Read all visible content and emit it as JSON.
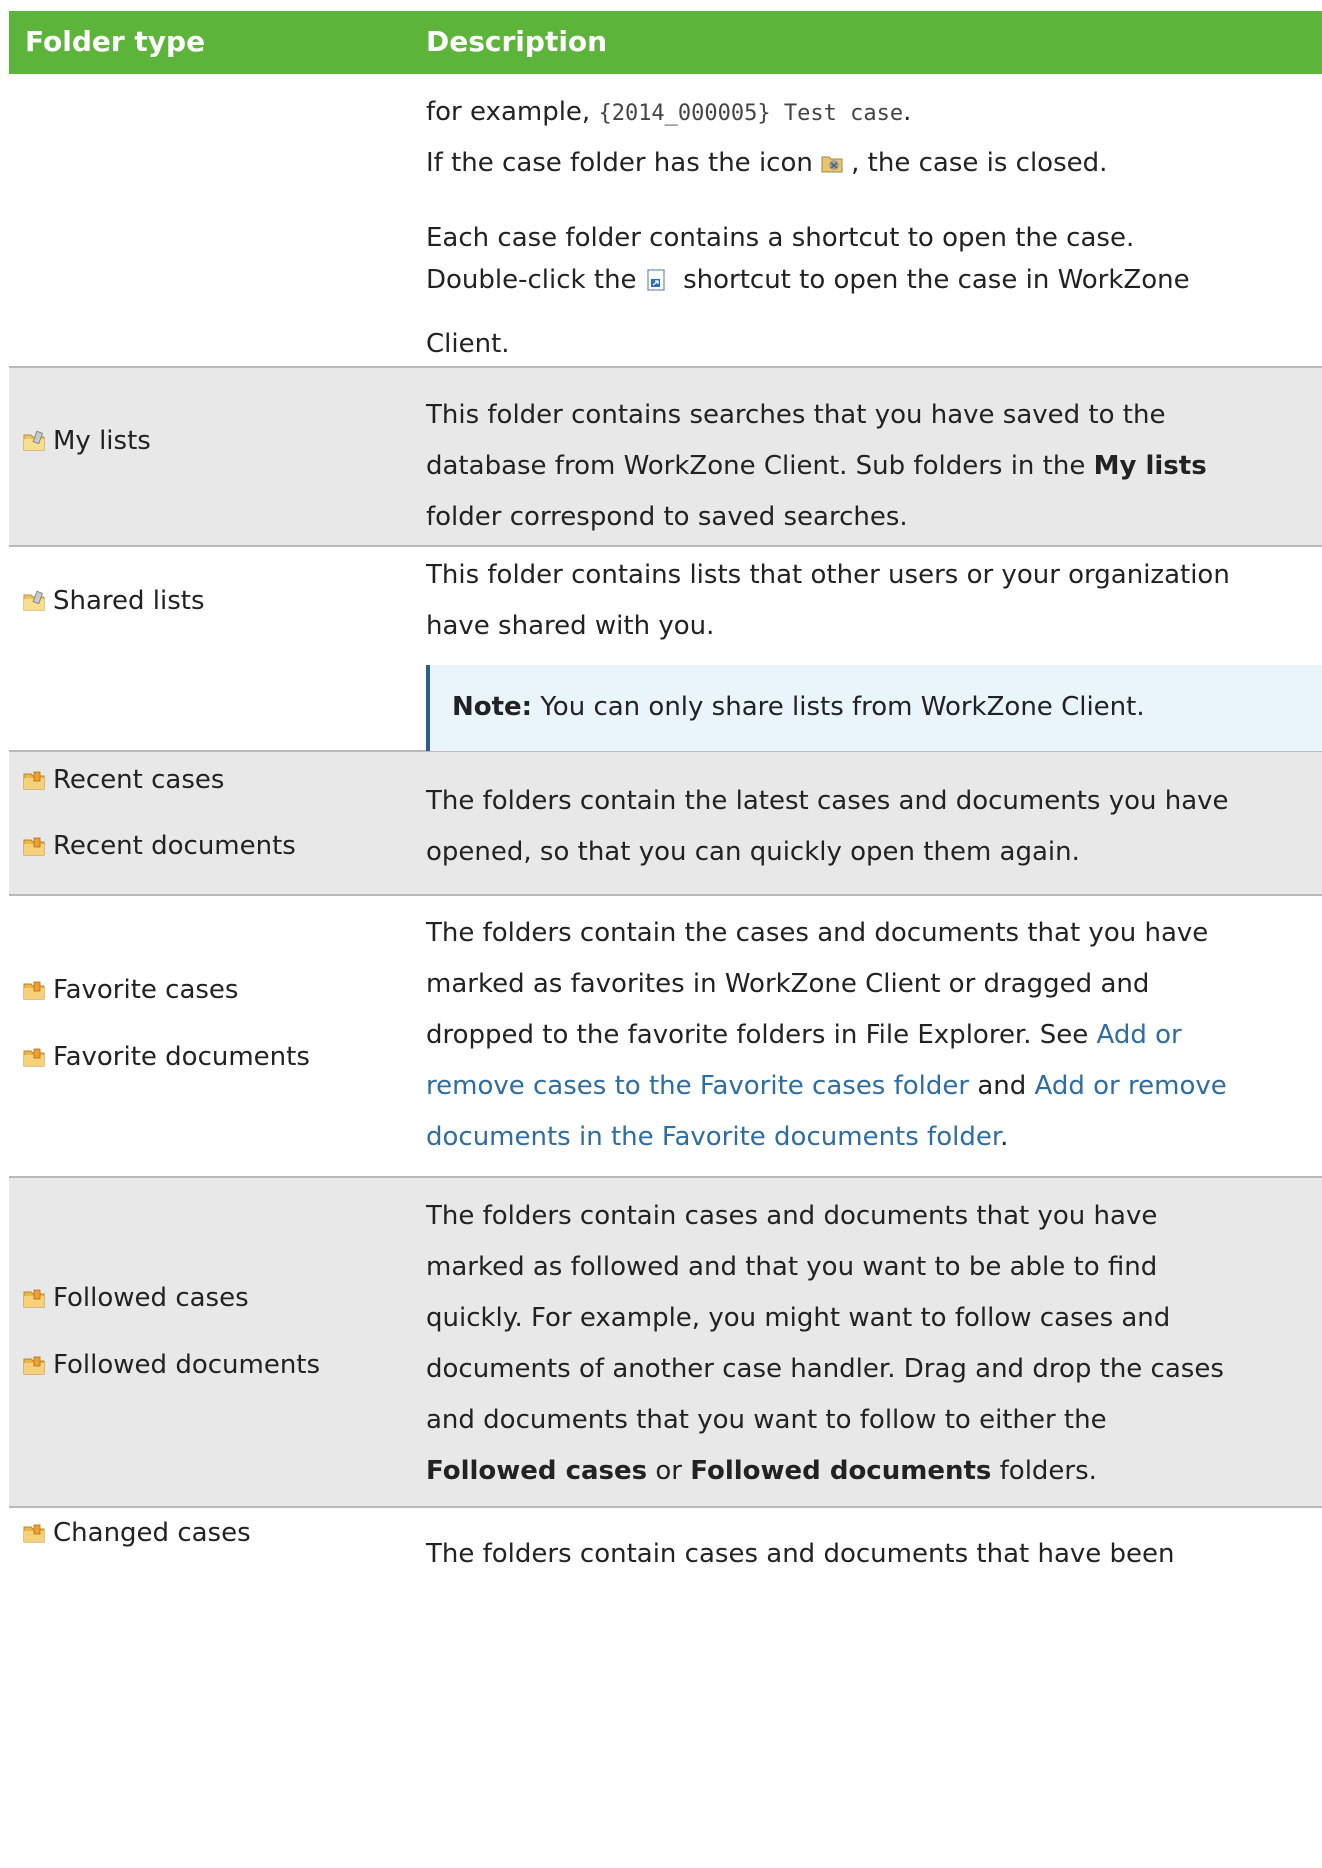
{
  "header": {
    "col1": "Folder type",
    "col2": "Description"
  },
  "row0": {
    "l1_pre": "for example, ",
    "l1_code": "{2014_000005} Test case",
    "l1_post": ".",
    "l2_pre": "If the case folder has the icon ",
    "l2_post": ", the case is closed.",
    "l3": "Each case folder contains a shortcut to open the case.",
    "l4_pre": "Double-click the ",
    "l4_post": " shortcut to open the case in WorkZone",
    "l5": "Client."
  },
  "my_lists": {
    "name": "My lists",
    "l1": "This folder contains searches that you have saved to the",
    "l2_pre": "database from WorkZone Client. Sub folders in the ",
    "l2_bold": "My lists",
    "l3": "folder correspond to saved searches."
  },
  "shared_lists": {
    "name": "Shared lists",
    "l1": "This folder contains lists that other users or your organization",
    "l2": "have shared with you.",
    "note_label": "Note:",
    "note_text": " You can only share lists from WorkZone Client."
  },
  "recent": {
    "name1": "Recent cases",
    "name2": "Recent documents",
    "l1": "The folders contain the latest cases and documents you have",
    "l2": "opened, so that you can quickly open them again."
  },
  "favorite": {
    "name1": "Favorite cases",
    "name2": "Favorite documents",
    "l1": "The folders contain the cases and documents that you have",
    "l2": "marked as favorites in WorkZone Client or dragged and",
    "l3_pre": "dropped to the favorite folders in File Explorer. See ",
    "l3_link": "Add or",
    "l4_link1": "remove cases to the Favorite cases folder",
    "l4_mid": " and ",
    "l4_link2": "Add or remove",
    "l5_link": "documents in the Favorite documents folder",
    "l5_post": "."
  },
  "followed": {
    "name1": "Followed cases",
    "name2": "Followed documents",
    "l1": "The folders contain cases and documents that you have",
    "l2": "marked as followed and that you want to be able to find",
    "l3": "quickly. For example, you might want to follow cases and",
    "l4": "documents of another case handler. Drag and drop the cases",
    "l5": "and documents that you want to follow to either the",
    "l6_b1": "Followed cases",
    "l6_mid": " or ",
    "l6_b2": "Followed documents",
    "l6_post": " folders."
  },
  "changed": {
    "name1": "Changed cases",
    "l1": "The folders contain cases and documents that have been"
  },
  "colors": {
    "header_bg": "#5db43a",
    "alt_row": "#e8e8e8",
    "link": "#2e6da4",
    "note_bg": "#eaf4fb"
  },
  "icons": {
    "folder": "folder-icon",
    "closed_case": "closed-case-icon",
    "shortcut": "shortcut-icon"
  }
}
